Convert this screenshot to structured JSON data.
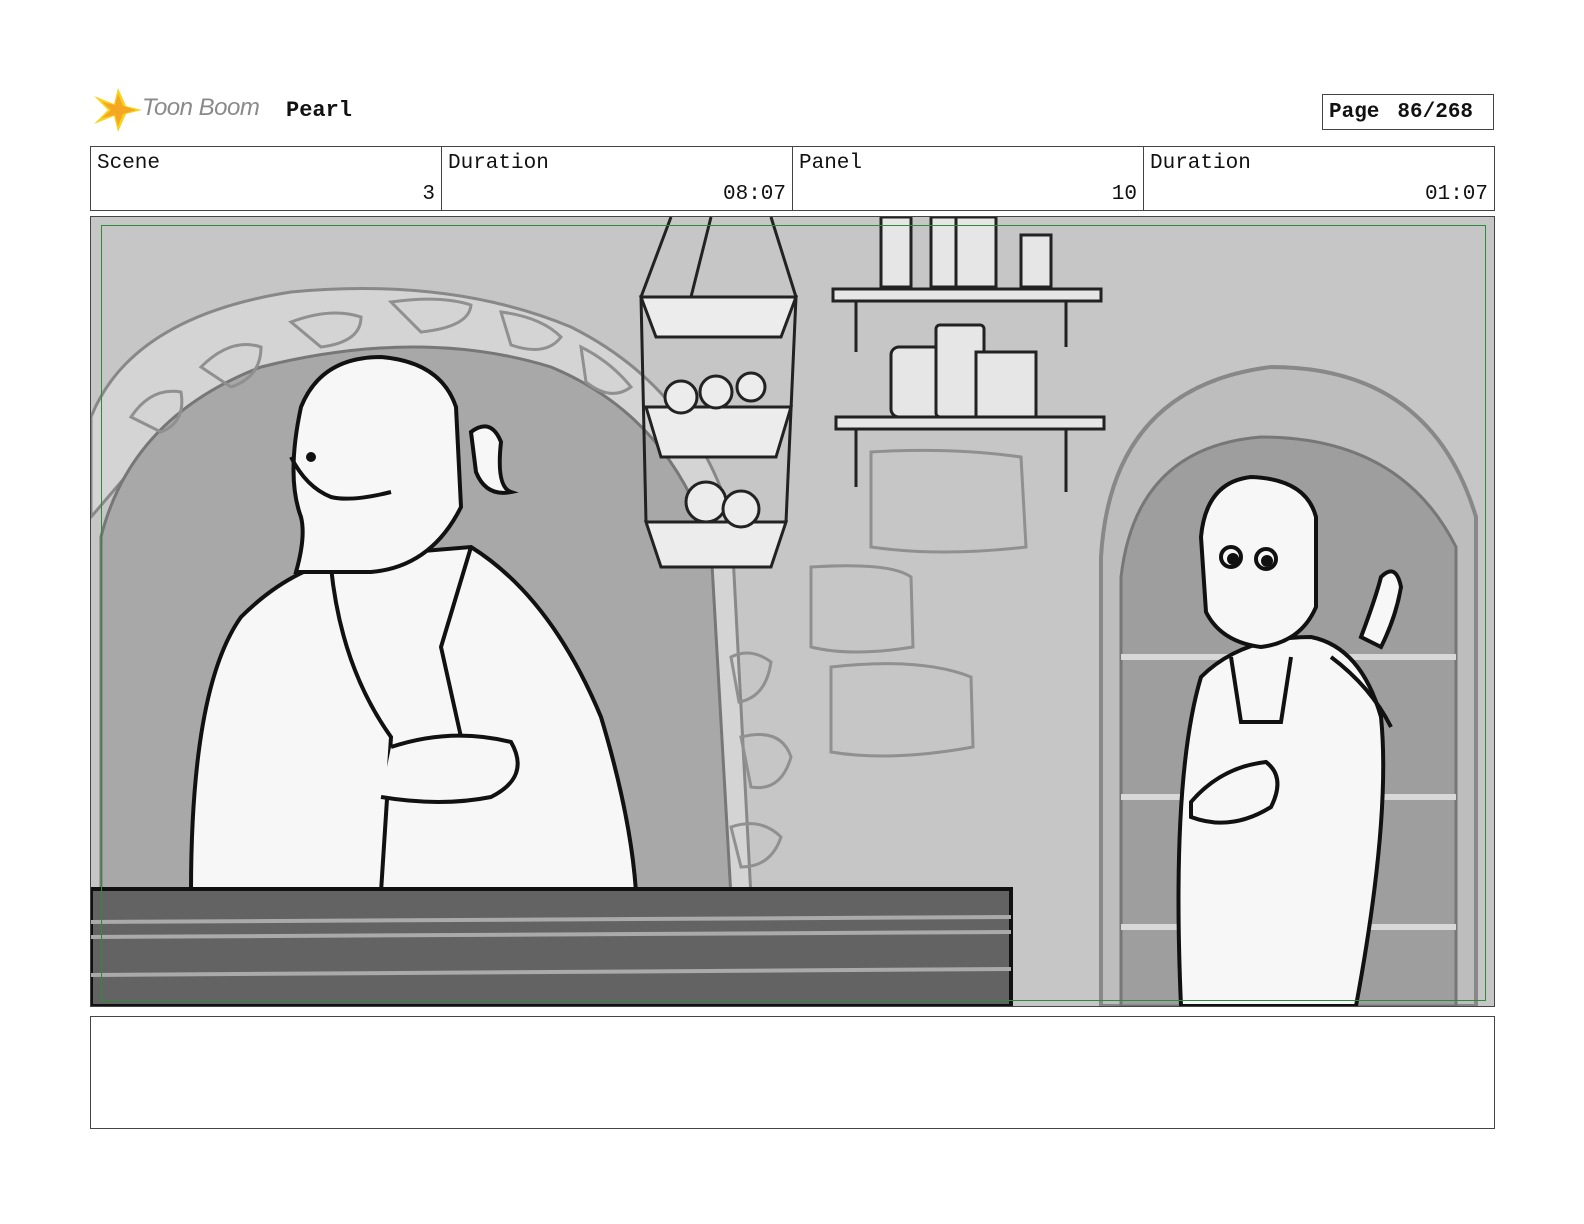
{
  "header": {
    "brand": "Toon Boom",
    "project": "Pearl",
    "page_label": "Page",
    "page_number": "86/268"
  },
  "info": {
    "scene_label": "Scene",
    "scene_value": "3",
    "scene_duration_label": "Duration",
    "scene_duration_value": "08:07",
    "panel_label": "Panel",
    "panel_value": "10",
    "panel_duration_label": "Duration",
    "panel_duration_value": "01:07"
  },
  "colors": {
    "safe_frame": "#2e8b3a",
    "logo_orange": "#f5a623",
    "logo_yellow": "#f8d21c"
  }
}
